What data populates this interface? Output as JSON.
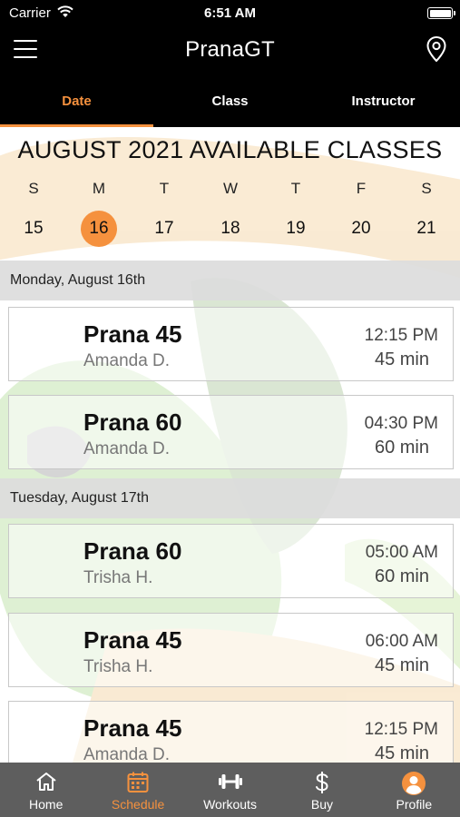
{
  "status_bar": {
    "carrier": "Carrier",
    "time": "6:51 AM"
  },
  "nav": {
    "title": "PranaGT",
    "menu_icon": "hamburger-menu-icon",
    "location_icon": "location-pin-icon"
  },
  "tabs": [
    {
      "label": "Date",
      "active": true
    },
    {
      "label": "Class",
      "active": false
    },
    {
      "label": "Instructor",
      "active": false
    }
  ],
  "calendar": {
    "title": "AUGUST 2021 AVAILABLE CLASSES",
    "weekdays": [
      "S",
      "M",
      "T",
      "W",
      "T",
      "F",
      "S"
    ],
    "days": [
      "15",
      "16",
      "17",
      "18",
      "19",
      "20",
      "21"
    ],
    "selected_day": "16"
  },
  "sections": [
    {
      "header": "Monday, August 16th",
      "classes": [
        {
          "name": "Prana 45",
          "instructor": "Amanda D.",
          "time": "12:15 PM",
          "duration": "45 min"
        },
        {
          "name": "Prana 60",
          "instructor": "Amanda D.",
          "time": "04:30 PM",
          "duration": "60 min"
        }
      ]
    },
    {
      "header": "Tuesday, August 17th",
      "classes": [
        {
          "name": "Prana 60",
          "instructor": "Trisha H.",
          "time": "05:00 AM",
          "duration": "60 min"
        },
        {
          "name": "Prana 45",
          "instructor": "Trisha H.",
          "time": "06:00 AM",
          "duration": "45 min"
        },
        {
          "name": "Prana 45",
          "instructor": "Amanda D.",
          "time": "12:15 PM",
          "duration": "45 min"
        }
      ]
    }
  ],
  "bottom_tabs": [
    {
      "label": "Home",
      "icon": "home-icon",
      "active": false
    },
    {
      "label": "Schedule",
      "icon": "calendar-icon",
      "active": true
    },
    {
      "label": "Workouts",
      "icon": "dumbbell-icon",
      "active": false
    },
    {
      "label": "Buy",
      "icon": "dollar-icon",
      "active": false
    },
    {
      "label": "Profile",
      "icon": "profile-avatar-icon",
      "active": false
    }
  ],
  "colors": {
    "accent": "#f5913e",
    "bar_background": "#000000",
    "tab_bar_background": "#5e5e5e"
  }
}
